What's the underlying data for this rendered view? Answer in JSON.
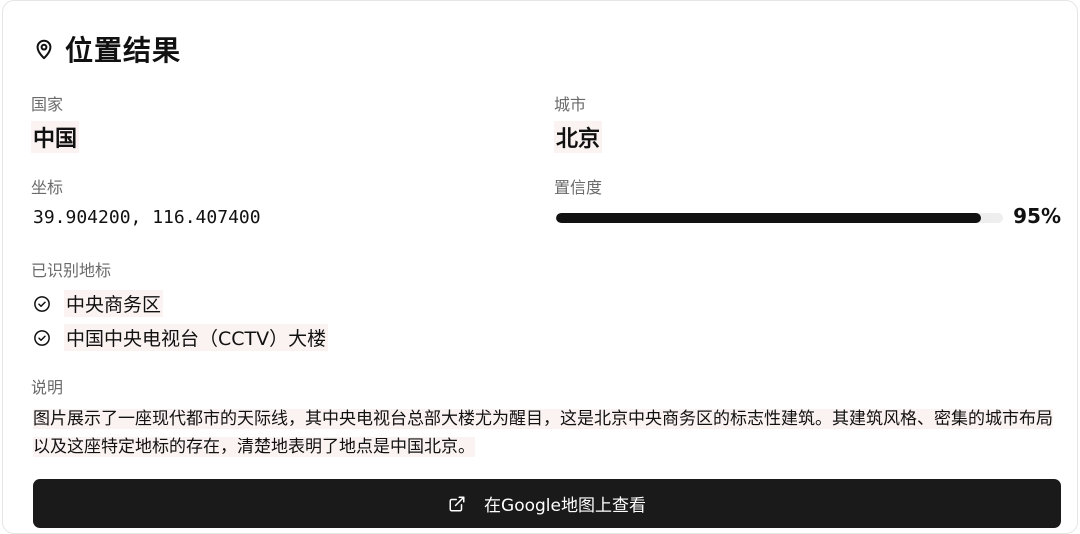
{
  "header": {
    "title": "位置结果",
    "icon": "map-pin-icon"
  },
  "country": {
    "label": "国家",
    "value": "中国"
  },
  "city": {
    "label": "城市",
    "value": "北京"
  },
  "coordinates": {
    "label": "坐标",
    "value": "39.904200, 116.407400"
  },
  "confidence": {
    "label": "置信度",
    "value": 0.95,
    "text": "95%"
  },
  "landmarks": {
    "label": "已识别地标",
    "items": [
      {
        "name": "中央商务区",
        "icon": "check-circle-icon"
      },
      {
        "name": "中国中央电视台（CCTV）大楼",
        "icon": "check-circle-icon"
      }
    ]
  },
  "description": {
    "label": "说明",
    "text": "图片展示了一座现代都市的天际线，其中央电视台总部大楼尤为醒目，这是北京中央商务区的标志性建筑。其建筑风格、密集的城市布局以及这座特定地标的存在，清楚地表明了地点是中国北京。"
  },
  "map_button": {
    "label": "在Google地图上查看",
    "icon": "external-link-icon"
  },
  "colors": {
    "accent": "#111111",
    "highlight": "#fbf3f1",
    "button_bg": "#1a1a1a"
  }
}
